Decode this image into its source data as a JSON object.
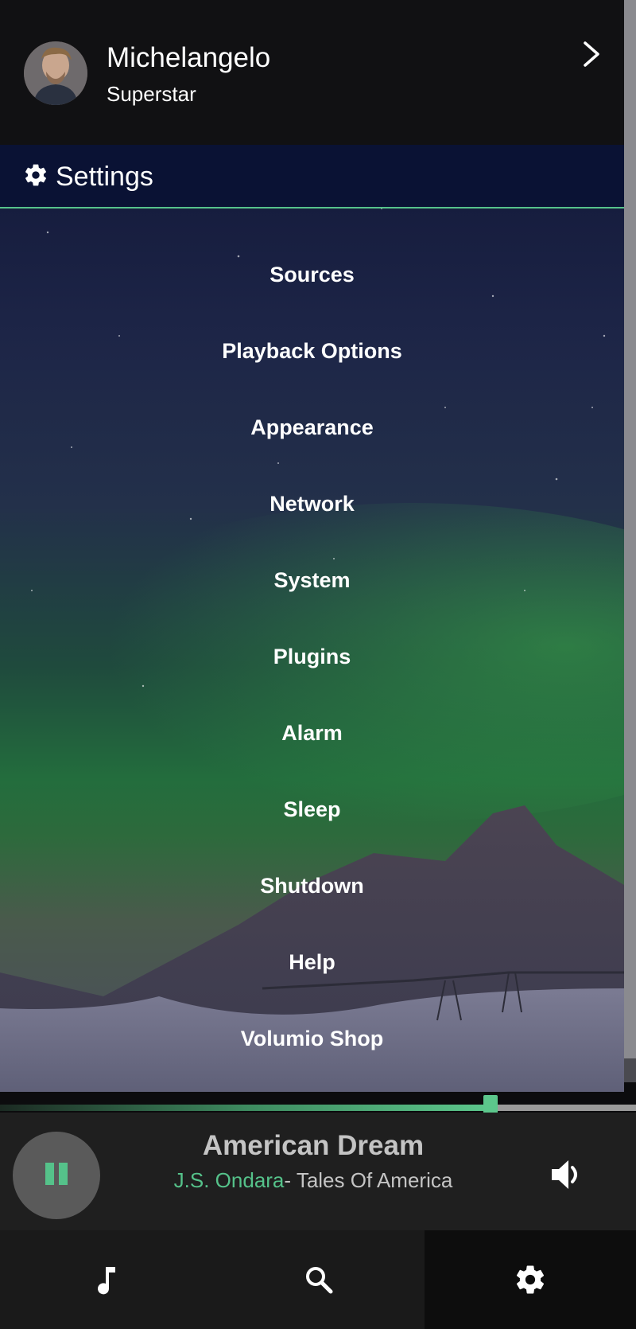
{
  "header": {
    "name": "Michelangelo",
    "subtitle": "Superstar",
    "icon_avatar": "user-avatar",
    "icon_chevron": "chevron-right-icon"
  },
  "settings": {
    "title": "Settings",
    "icon": "gear-icon"
  },
  "menu": {
    "items": [
      {
        "label": "Sources"
      },
      {
        "label": "Playback Options"
      },
      {
        "label": "Appearance"
      },
      {
        "label": "Network"
      },
      {
        "label": "System"
      },
      {
        "label": "Plugins"
      },
      {
        "label": "Alarm"
      },
      {
        "label": "Sleep"
      },
      {
        "label": "Shutdown"
      },
      {
        "label": "Help"
      },
      {
        "label": "Volumio Shop"
      }
    ]
  },
  "player": {
    "title": "American Dream",
    "artist": "J.S. Ondara",
    "album_sep": "- ",
    "album": "Tales Of America",
    "progress": 0.77,
    "state_icon": "pause-icon",
    "volume_icon": "volume-icon"
  },
  "nav": {
    "tabs": [
      {
        "name": "browse",
        "icon": "music-note-icon"
      },
      {
        "name": "search",
        "icon": "search-icon"
      },
      {
        "name": "settings",
        "icon": "gear-icon",
        "active": true
      }
    ]
  },
  "colors": {
    "accent": "#55c28a",
    "header_bg": "#111113",
    "player_bg": "#1f1f1f",
    "nav_bg": "#1a1a1a"
  }
}
